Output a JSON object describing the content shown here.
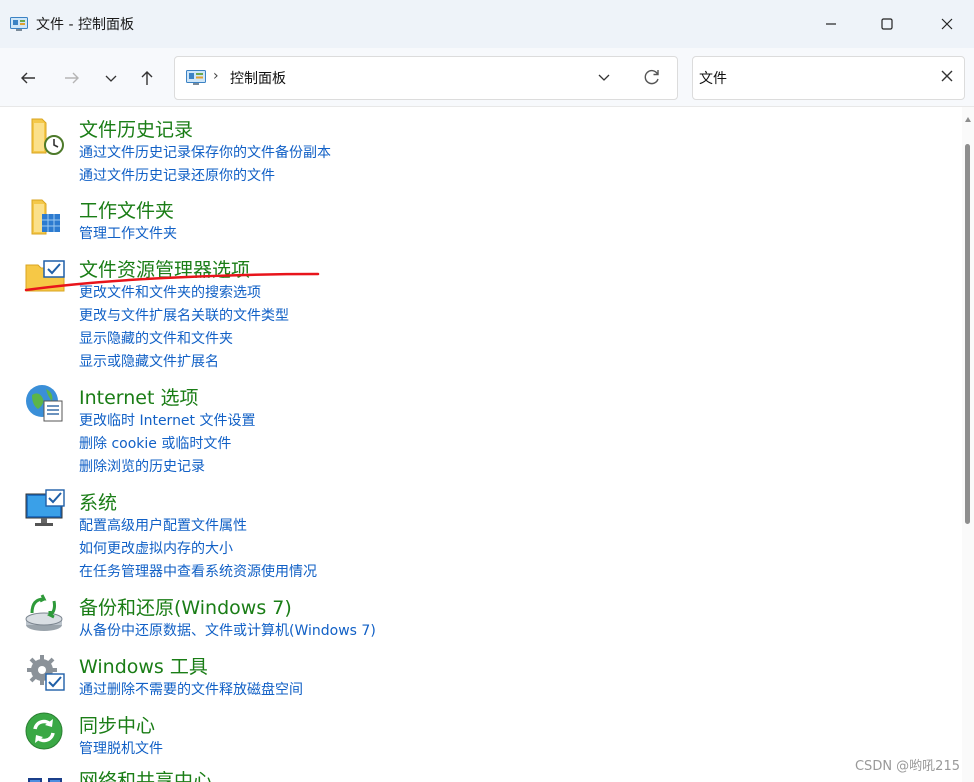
{
  "window": {
    "title": "文件 - 控制面板",
    "icon": "control-panel-icon"
  },
  "toolbar": {
    "address_separator": "›",
    "address_text": "控制面板",
    "search_value": "文件"
  },
  "items": [
    {
      "title": "文件历史记录",
      "icon": "file-history-icon",
      "links": [
        "通过文件历史记录保存你的文件备份副本",
        "通过文件历史记录还原你的文件"
      ]
    },
    {
      "title": "工作文件夹",
      "icon": "work-folders-icon",
      "links": [
        "管理工作文件夹"
      ]
    },
    {
      "title": "文件资源管理器选项",
      "icon": "explorer-options-icon",
      "links": [
        "更改文件和文件夹的搜索选项",
        "更改与文件扩展名关联的文件类型",
        "显示隐藏的文件和文件夹",
        "显示或隐藏文件扩展名"
      ]
    },
    {
      "title": "Internet 选项",
      "icon": "internet-options-icon",
      "links": [
        "更改临时 Internet 文件设置",
        "删除 cookie 或临时文件",
        "删除浏览的历史记录"
      ]
    },
    {
      "title": "系统",
      "icon": "system-icon",
      "links": [
        "配置高级用户配置文件属性",
        "如何更改虚拟内存的大小",
        "在任务管理器中查看系统资源使用情况"
      ]
    },
    {
      "title": "备份和还原(Windows 7)",
      "icon": "backup-restore-icon",
      "links": [
        "从备份中还原数据、文件或计算机(Windows 7)"
      ]
    },
    {
      "title": "Windows 工具",
      "icon": "windows-tools-icon",
      "links": [
        "通过删除不需要的文件释放磁盘空间"
      ]
    },
    {
      "title": "同步中心",
      "icon": "sync-center-icon",
      "links": [
        "管理脱机文件"
      ]
    },
    {
      "title": "网络和共享中心",
      "icon": "network-sharing-icon",
      "links": []
    }
  ],
  "colors": {
    "title_green": "#1a7d16",
    "link_blue": "#1160c6",
    "annotation_red": "#e8141b"
  },
  "watermark": "CSDN @哟吼215"
}
